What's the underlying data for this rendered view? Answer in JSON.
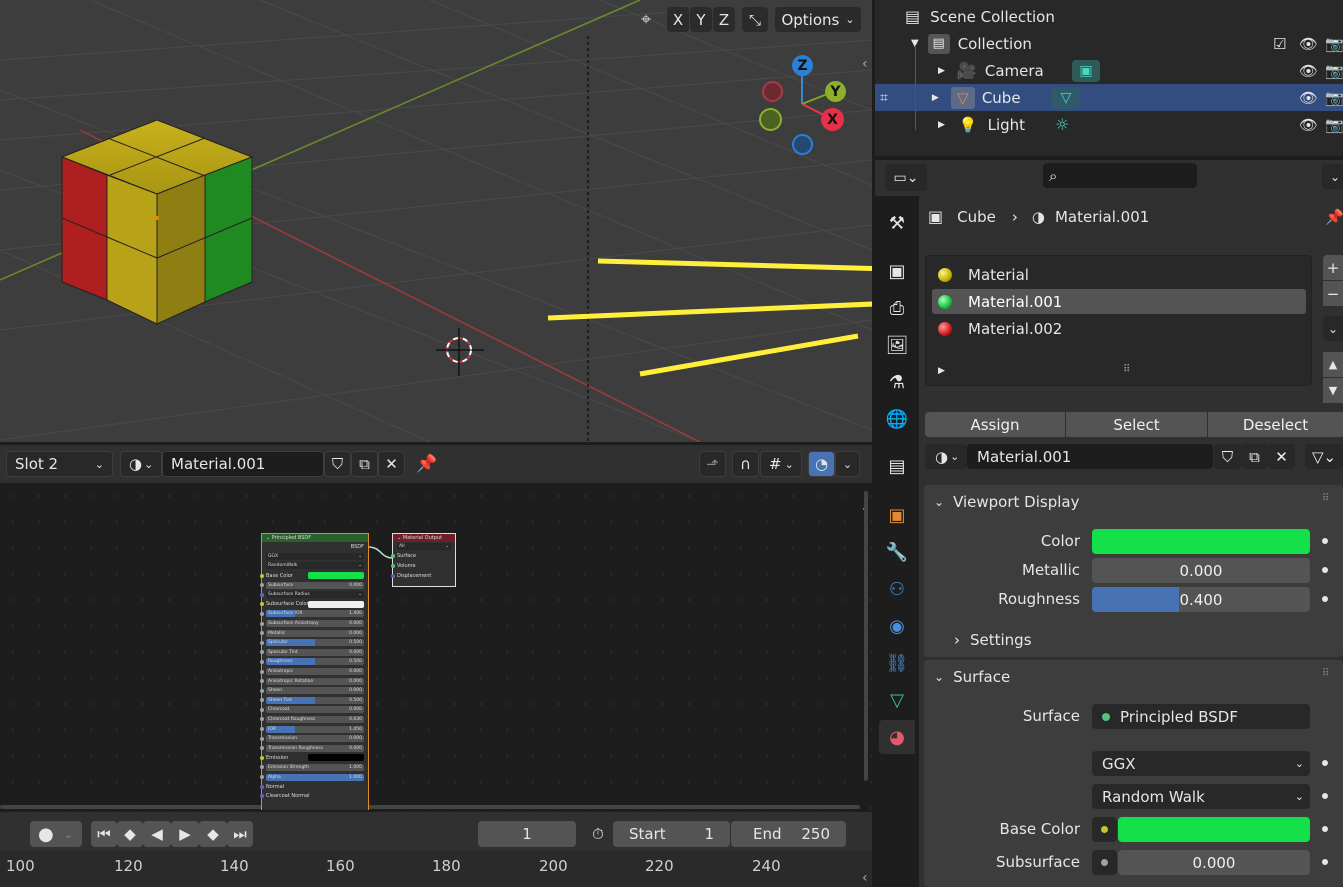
{
  "viewport": {
    "axis_buttons": [
      "X",
      "Y",
      "Z"
    ],
    "options_label": "Options",
    "gizmo": {
      "z": "Z",
      "y": "Y",
      "x": "X"
    }
  },
  "node_editor": {
    "slot_label": "Slot 2",
    "material_name": "Material.001",
    "nodes": {
      "bsdf_title": "Principled BSDF",
      "bsdf_out": "BSDF",
      "bsdf_rows": [
        {
          "label": "GGX",
          "type": "dd"
        },
        {
          "label": "RandomWalk",
          "type": "dd"
        },
        {
          "label": "Base Color",
          "type": "color"
        },
        {
          "label": "Subsurface",
          "value": "0.000"
        },
        {
          "label": "Subsurface Radius",
          "type": "dd"
        },
        {
          "label": "Subsurface Color",
          "type": "white"
        },
        {
          "label": "Subsurface IOR",
          "value": "1.400",
          "fill": 0.3
        },
        {
          "label": "Subsurface Anisotropy",
          "value": "0.000"
        },
        {
          "label": "Metallic",
          "value": "0.000"
        },
        {
          "label": "Specular",
          "value": "0.500",
          "fill": 0.5
        },
        {
          "label": "Specular Tint",
          "value": "0.000"
        },
        {
          "label": "Roughness",
          "value": "0.500",
          "fill": 0.5
        },
        {
          "label": "Anisotropic",
          "value": "0.000"
        },
        {
          "label": "Anisotropic Rotation",
          "value": "0.000"
        },
        {
          "label": "Sheen",
          "value": "0.000"
        },
        {
          "label": "Sheen Tint",
          "value": "0.500",
          "fill": 0.5
        },
        {
          "label": "Clearcoat",
          "value": "0.000"
        },
        {
          "label": "Clearcoat Roughness",
          "value": "0.030"
        },
        {
          "label": "IOR",
          "value": "1.450",
          "fill": 0.3
        },
        {
          "label": "Transmission",
          "value": "0.000"
        },
        {
          "label": "Transmission Roughness",
          "value": "0.000"
        },
        {
          "label": "Emission",
          "type": "black"
        },
        {
          "label": "Emission Strength",
          "value": "1.000"
        },
        {
          "label": "Alpha",
          "value": "1.000",
          "fill": 1.0
        },
        {
          "label": "Normal",
          "type": "socket"
        },
        {
          "label": "Clearcoat Normal",
          "type": "socket"
        }
      ],
      "output_title": "Material Output",
      "output_target": "All",
      "output_sockets": [
        "Surface",
        "Volume",
        "Displacement"
      ]
    }
  },
  "timeline": {
    "current_frame": "1",
    "start_label": "Start",
    "start_value": "1",
    "end_label": "End",
    "end_value": "250",
    "ruler": [
      "100",
      "120",
      "140",
      "160",
      "180",
      "200",
      "220",
      "240"
    ]
  },
  "outliner": {
    "scene_collection": "Scene Collection",
    "collection": "Collection",
    "items": [
      "Camera",
      "Cube",
      "Light"
    ]
  },
  "properties": {
    "breadcrumb_object": "Cube",
    "breadcrumb_material": "Material.001",
    "slots": [
      "Material",
      "Material.001",
      "Material.002"
    ],
    "assign_label": "Assign",
    "select_label": "Select",
    "deselect_label": "Deselect",
    "material_name": "Material.001",
    "viewport_display": {
      "title": "Viewport Display",
      "color_label": "Color",
      "metallic_label": "Metallic",
      "metallic_value": "0.000",
      "roughness_label": "Roughness",
      "roughness_value": "0.400",
      "roughness_fraction": 0.4,
      "settings_label": "Settings"
    },
    "surface": {
      "title": "Surface",
      "surface_label": "Surface",
      "surface_value": "Principled BSDF",
      "distribution": "GGX",
      "subsurface_method": "Random Walk",
      "base_color_label": "Base Color",
      "subsurface_label": "Subsurface",
      "subsurface_value": "0.000"
    }
  },
  "colors": {
    "accent_blue": "#4772b3",
    "green_material": "#14e04a",
    "selection": "#334d80",
    "annotation_yellow": "#ffef3a"
  }
}
